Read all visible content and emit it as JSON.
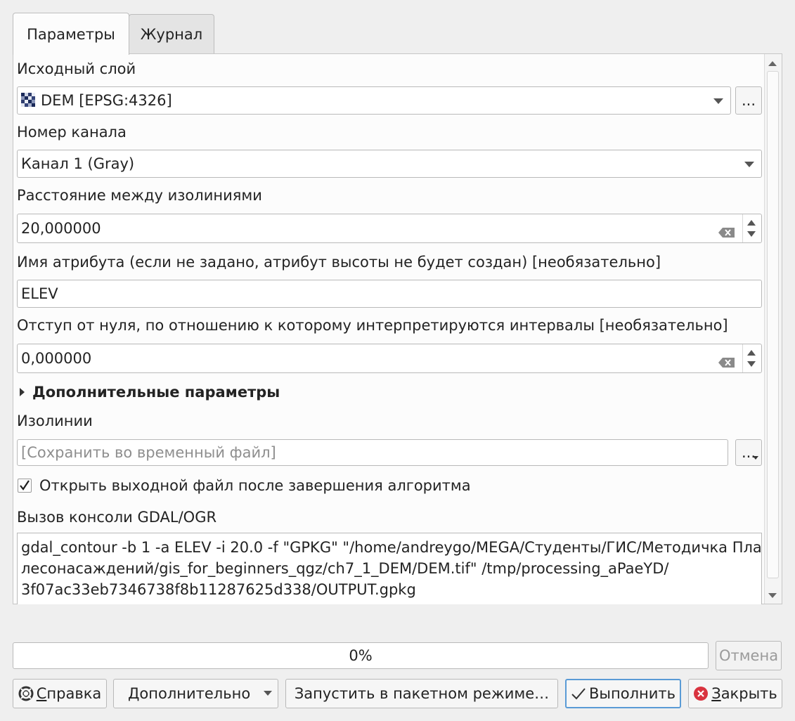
{
  "tabs": {
    "params": "Параметры",
    "log": "Журнал"
  },
  "input_layer": {
    "label": "Исходный слой",
    "value": "DEM [EPSG:4326]",
    "browse": "..."
  },
  "band": {
    "label": "Номер канала",
    "value": "Канал 1 (Gray)"
  },
  "interval": {
    "label": "Расстояние между изолиниями",
    "value": "20,000000"
  },
  "attribute": {
    "label": "Имя атрибута (если не задано, атрибут высоты не будет создан) [необязательно]",
    "value": "ELEV"
  },
  "offset": {
    "label": "Отступ от нуля, по отношению к которому интерпретируются интервалы [необязательно]",
    "value": "0,000000"
  },
  "advanced": {
    "label": "Дополнительные параметры"
  },
  "output": {
    "label": "Изолинии",
    "placeholder": "[Сохранить во временный файл]",
    "browse": "..."
  },
  "open_output": {
    "label": "Открыть выходной файл после завершения алгоритма",
    "checked": true
  },
  "console": {
    "label": "Вызов консоли GDAL/OGR",
    "line1": "gdal_contour -b 1 -a ELEV -i 20.0 -f \"GPKG\" \"/home/andreygo/MEGA/Студенты/ГИС/Методичка План",
    "line2": "лесонасаждений/gis_for_beginners_qgz/ch7_1_DEM/DEM.tif\" /tmp/processing_aPaeYD/",
    "line3": "3f07ac33eb7346738f8b11287625d338/OUTPUT.gpkg"
  },
  "progress": {
    "text": "0%",
    "value": 0
  },
  "buttons": {
    "cancel": "Отмена",
    "help_first": "С",
    "help_rest": "правка",
    "advanced": "Дополнительно",
    "batch": "Запустить в пакетном режиме…",
    "run": "Выполнить",
    "close_first": "З",
    "close_rest": "акрыть"
  },
  "colors": {
    "close_icon": "#d9333f",
    "panel_bg": "#fcfcfc",
    "window_bg": "#efefef"
  }
}
